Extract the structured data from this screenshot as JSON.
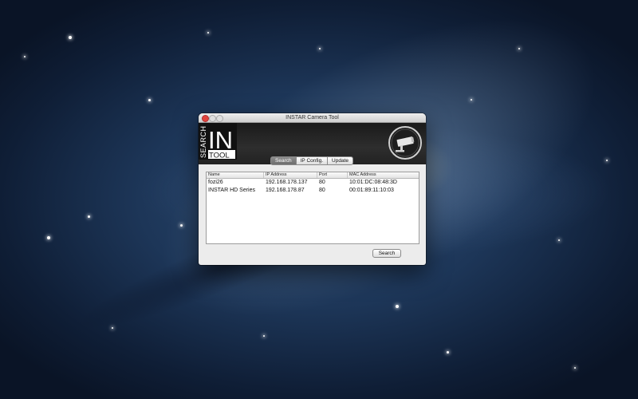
{
  "window": {
    "title": "INSTAR Camera Tool",
    "logo_text": {
      "line1": "SEARCH",
      "big": "IN",
      "line2": "TOOL"
    }
  },
  "tabs": [
    {
      "label": "Search",
      "active": true
    },
    {
      "label": "IP Config.",
      "active": false
    },
    {
      "label": "Update",
      "active": false
    }
  ],
  "table": {
    "columns": [
      "Name",
      "IP Address",
      "Port",
      "MAC Address"
    ],
    "rows": [
      [
        "fozi26",
        "192.168.178.137",
        "80",
        "10:01:DC:08:48:3D"
      ],
      [
        "INSTAR HD Series",
        "192.168.178.87",
        "80",
        "00:01:89:11:10:03"
      ]
    ]
  },
  "buttons": {
    "search_label": "Search"
  },
  "colors": {
    "close": "#e0443e",
    "header": "#1a1a1a",
    "active_tab": "#7a7a7a"
  },
  "icons": [
    "security-camera-icon",
    "search-in-tool-logo"
  ]
}
